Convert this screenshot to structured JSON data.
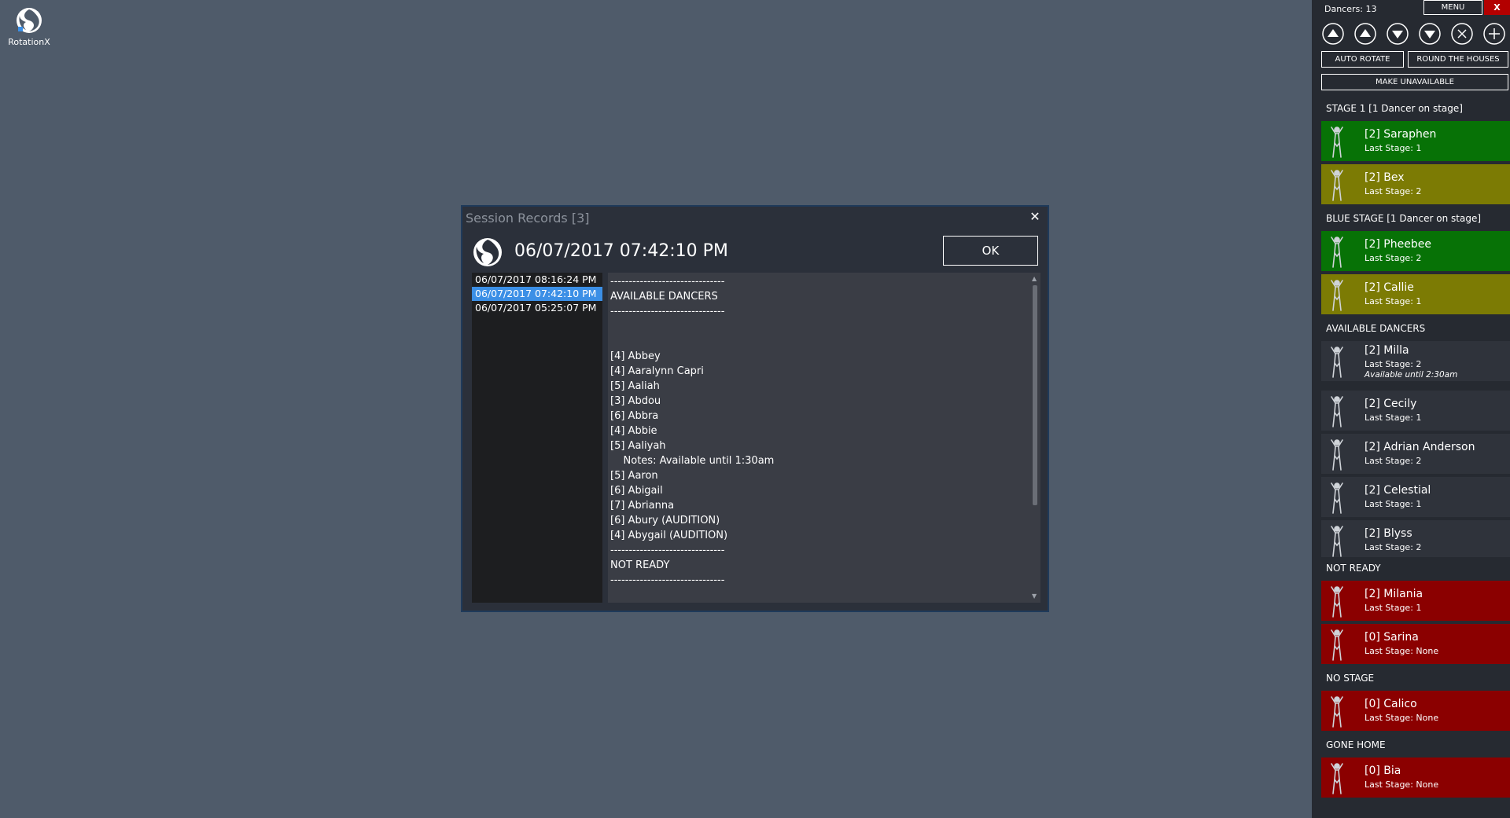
{
  "desktop": {
    "app_label": "RotationX"
  },
  "modal": {
    "title": "Session Records [3]",
    "close_glyph": "✕",
    "heading": "06/07/2017 07:42:10 PM",
    "ok_label": "OK",
    "records": [
      {
        "label": "06/07/2017 08:16:24 PM",
        "selected": false
      },
      {
        "label": "06/07/2017 07:42:10 PM",
        "selected": true
      },
      {
        "label": "06/07/2017 05:25:07 PM",
        "selected": false
      }
    ],
    "content_lines": [
      "-------------------------------",
      "AVAILABLE DANCERS",
      "-------------------------------",
      "",
      "",
      "[4] Abbey",
      "[4] Aaralynn Capri",
      "[5] Aaliah",
      "[3] Abdou",
      "[6] Abbra",
      "[4] Abbie",
      "[5] Aaliyah",
      "    Notes: Available until 1:30am",
      "[5] Aaron",
      "[6] Abigail",
      "[7] Abrianna",
      "[6] Abury (AUDITION)",
      "[4] Abygail (AUDITION)",
      "-------------------------------",
      "NOT READY",
      "-------------------------------",
      "",
      "",
      "-------------------------------"
    ]
  },
  "panel": {
    "dancers_count": "Dancers: 13",
    "menu_label": "MENU",
    "close_label": "X",
    "auto_rotate_label": "AUTO ROTATE",
    "round_houses_label": "ROUND THE HOUSES",
    "make_unavailable_label": "MAKE UNAVAILABLE",
    "controls": [
      "move-top-icon",
      "move-up-icon",
      "move-down-icon",
      "move-bottom-icon",
      "remove-icon",
      "add-icon"
    ],
    "colors": {
      "green": "#077206",
      "olive": "#7c7b04",
      "gray": "#2f333b",
      "red": "#8b0000",
      "close_red": "#b30000"
    },
    "sections": [
      {
        "header": "STAGE  1  [1 Dancer on stage]",
        "dancers": [
          {
            "name": "[2] Saraphen",
            "stage": "Last Stage:  1",
            "color": "green"
          },
          {
            "name": "[2] Bex",
            "stage": "Last Stage:  2",
            "color": "olive"
          }
        ]
      },
      {
        "header": "BLUE STAGE  [1 Dancer on stage]",
        "dancers": [
          {
            "name": "[2] Pheebee",
            "stage": "Last Stage:  2",
            "color": "green"
          },
          {
            "name": "[2] Callie",
            "stage": "Last Stage:  1",
            "color": "olive"
          }
        ]
      },
      {
        "header": "AVAILABLE  DANCERS",
        "dancers": [
          {
            "name": "[2] Milla",
            "stage": "Last Stage:  2",
            "note": "Available until 2:30am",
            "color": "gray"
          },
          {
            "name": "[2] Cecily",
            "stage": "Last Stage:  1",
            "color": "gray"
          },
          {
            "name": "[2] Adrian Anderson",
            "stage": "Last Stage:  2",
            "color": "gray"
          },
          {
            "name": "[2] Celestial",
            "stage": "Last Stage:  1",
            "color": "gray"
          },
          {
            "name": "[2] Blyss",
            "stage": "Last Stage:  2",
            "color": "gray"
          }
        ]
      },
      {
        "header": "NOT READY",
        "dancers": [
          {
            "name": "[2] Milania",
            "stage": "Last Stage:  1",
            "color": "red"
          },
          {
            "name": "[0] Sarina",
            "stage": "Last Stage:  None",
            "color": "red"
          }
        ]
      },
      {
        "header": "NO STAGE",
        "dancers": [
          {
            "name": "[0] Calico",
            "stage": "Last Stage:  None",
            "color": "red"
          }
        ]
      },
      {
        "header": "GONE HOME",
        "dancers": [
          {
            "name": "[0] Bia",
            "stage": "Last Stage:  None",
            "color": "red"
          }
        ]
      }
    ]
  }
}
